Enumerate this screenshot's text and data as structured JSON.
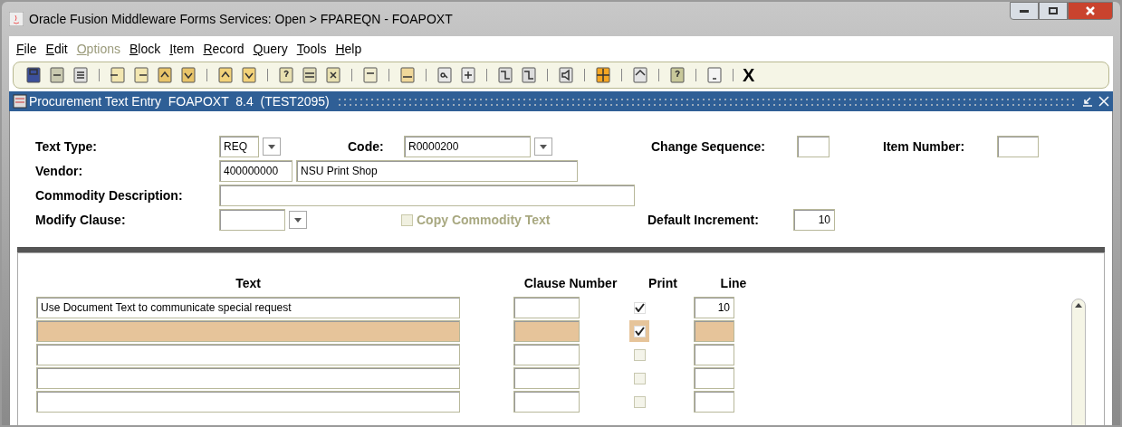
{
  "window": {
    "title": "Oracle Fusion Middleware Forms Services:  Open > FPAREQN - FOAPOXT"
  },
  "menu": [
    {
      "label": "File",
      "disabled": false
    },
    {
      "label": "Edit",
      "disabled": false
    },
    {
      "label": "Options",
      "disabled": true
    },
    {
      "label": "Block",
      "disabled": false
    },
    {
      "label": "Item",
      "disabled": false
    },
    {
      "label": "Record",
      "disabled": false
    },
    {
      "label": "Query",
      "disabled": false
    },
    {
      "label": "Tools",
      "disabled": false
    },
    {
      "label": "Help",
      "disabled": false
    }
  ],
  "toolbar": {
    "exit_label": "X"
  },
  "form": {
    "title": "Procurement Text Entry  FOAPOXT  8.4  (TEST2095)"
  },
  "header": {
    "text_type": {
      "label": "Text Type:",
      "value": "REQ"
    },
    "code": {
      "label": "Code:",
      "value": "R0000200"
    },
    "change_sequence": {
      "label": "Change Sequence:"
    },
    "item_number": {
      "label": "Item Number:"
    },
    "vendor": {
      "label": "Vendor:",
      "id": "400000000",
      "name": "NSU Print Shop"
    },
    "commodity_description": {
      "label": "Commodity Description:"
    },
    "modify_clause": {
      "label": "Modify Clause:"
    },
    "copy_commodity_text": {
      "label": "Copy Commodity Text",
      "checked": false,
      "disabled": true
    },
    "default_increment": {
      "label": "Default Increment:",
      "value": "10"
    }
  },
  "table": {
    "columns": [
      "Text",
      "Clause Number",
      "Print",
      "Line"
    ],
    "rows": [
      {
        "text": "Use Document Text to communicate special request",
        "print": true,
        "print_disabled": false,
        "line": "10",
        "selected": false
      },
      {
        "print": true,
        "print_disabled": false,
        "selected": true
      },
      {
        "print": false,
        "print_disabled": true,
        "selected": false
      },
      {
        "print": false,
        "print_disabled": true,
        "selected": false
      },
      {
        "print": false,
        "print_disabled": true,
        "selected": false
      }
    ]
  }
}
